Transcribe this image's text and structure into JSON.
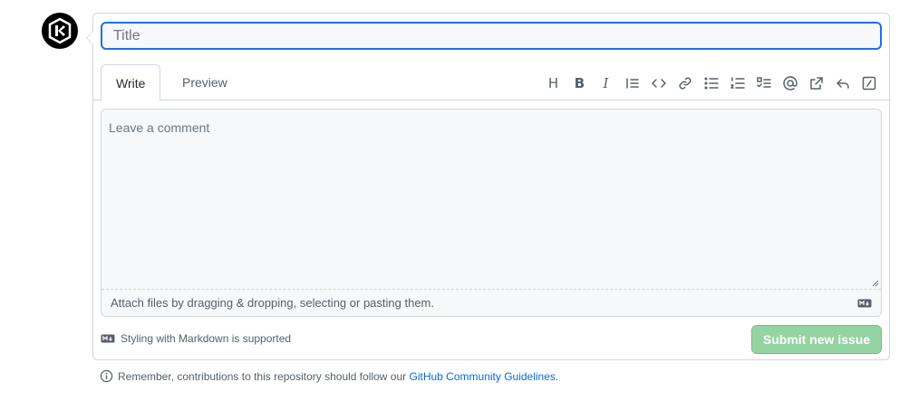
{
  "title_input": {
    "placeholder": "Title",
    "value": ""
  },
  "tabs": [
    {
      "label": "Write",
      "active": true
    },
    {
      "label": "Preview",
      "active": false
    }
  ],
  "toolbar": {
    "heading_glyph": "H",
    "bold_glyph": "B",
    "italic_glyph": "I",
    "icons": [
      "heading-icon",
      "bold-icon",
      "italic-icon",
      "quote-icon",
      "code-icon",
      "link-icon",
      "unordered-list-icon",
      "ordered-list-icon",
      "task-list-icon",
      "mention-icon",
      "reference-icon",
      "reply-icon",
      "slash-command-icon"
    ]
  },
  "comment": {
    "placeholder": "Leave a comment",
    "value": ""
  },
  "attach_text": "Attach files by dragging & dropping, selecting or pasting them.",
  "markdown_note": "Styling with Markdown is supported",
  "submit_label": "Submit new issue",
  "guidelines": {
    "prefix": "Remember, contributions to this repository should follow our",
    "link": "GitHub Community Guidelines",
    "suffix": "."
  },
  "colors": {
    "accent": "#1f6feb",
    "submit_disabled": "#94d3a2",
    "link": "#0969da"
  }
}
